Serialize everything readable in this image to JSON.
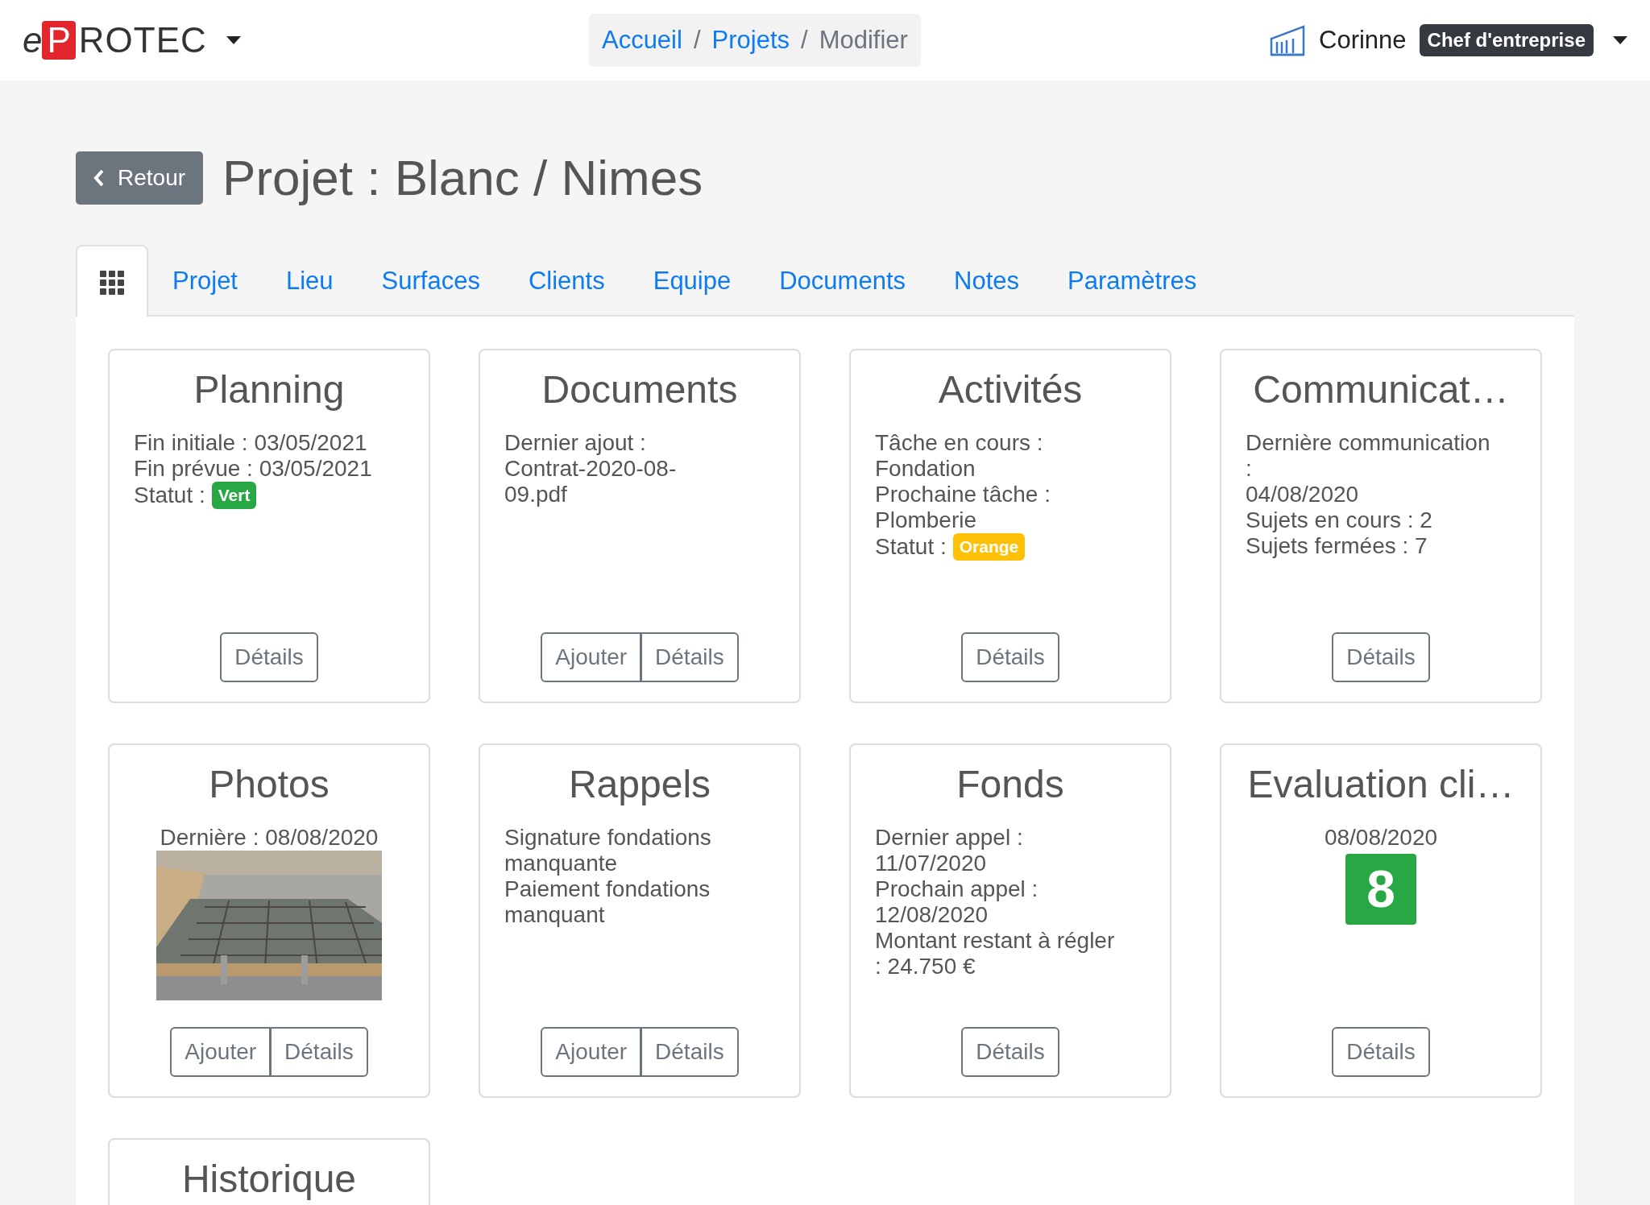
{
  "header": {
    "logo": {
      "prefix": "e",
      "mark": "P",
      "rest": "ROTEC"
    },
    "breadcrumb": [
      {
        "label": "Accueil",
        "link": true
      },
      {
        "label": "Projets",
        "link": true
      },
      {
        "label": "Modifier",
        "link": false
      }
    ],
    "separator": "/",
    "user": {
      "name": "Corinne",
      "role": "Chef d'entreprise"
    }
  },
  "back_button": "Retour",
  "title": "Projet : Blanc / Nimes",
  "tabs": [
    {
      "kind": "icon",
      "selected": true
    },
    {
      "kind": "text",
      "label": "Projet",
      "selected": false
    },
    {
      "kind": "text",
      "label": "Lieu",
      "selected": false
    },
    {
      "kind": "text",
      "label": "Surfaces",
      "selected": false
    },
    {
      "kind": "text",
      "label": "Clients",
      "selected": false
    },
    {
      "kind": "text",
      "label": "Equipe",
      "selected": false
    },
    {
      "kind": "text",
      "label": "Documents",
      "selected": false
    },
    {
      "kind": "text",
      "label": "Notes",
      "selected": false
    },
    {
      "kind": "text",
      "label": "Paramètres",
      "selected": false
    }
  ],
  "cards": [
    {
      "kind": "lines",
      "title": "Planning",
      "lines": [
        {
          "text": "Fin initiale : 03/05/2021"
        },
        {
          "text": "Fin prévue : 03/05/2021"
        },
        {
          "text": "Statut :",
          "badge": {
            "text": "Vert",
            "color": "#28a745"
          }
        }
      ],
      "buttons": [
        "Détails"
      ]
    },
    {
      "kind": "lines",
      "title": "Documents",
      "lines": [
        {
          "text": "Dernier ajout :"
        },
        {
          "text": "Contrat-2020-08-"
        },
        {
          "text": "09.pdf"
        }
      ],
      "buttons": [
        "Ajouter",
        "Détails"
      ]
    },
    {
      "kind": "lines",
      "title": "Activités",
      "lines": [
        {
          "text": "Tâche en cours :"
        },
        {
          "text": "Fondation"
        },
        {
          "text": "Prochaine tâche :"
        },
        {
          "text": "Plomberie"
        },
        {
          "text": "Statut :",
          "badge": {
            "text": "Orange",
            "color": "#ffc107"
          }
        }
      ],
      "buttons": [
        "Détails"
      ]
    },
    {
      "kind": "lines",
      "title": "Communicat…",
      "lines": [
        {
          "text": "Dernière communication"
        },
        {
          "text": ":"
        },
        {
          "text": "04/08/2020"
        },
        {
          "text": "Sujets en cours : 2"
        },
        {
          "text": "Sujets fermées : 7"
        }
      ],
      "buttons": [
        "Détails"
      ]
    },
    {
      "title": "Photos",
      "caption": "Dernière : 08/08/2020",
      "buttons": [
        "Ajouter",
        "Détails"
      ]
    },
    {
      "kind": "lines",
      "title": "Rappels",
      "lines": [
        {
          "text": "Signature fondations"
        },
        {
          "text": "manquante"
        },
        {
          "text": "Paiement fondations"
        },
        {
          "text": "manquant"
        }
      ],
      "buttons": [
        "Ajouter",
        "Détails"
      ]
    },
    {
      "kind": "lines",
      "title": "Fonds",
      "lines": [
        {
          "text": "Dernier appel :"
        },
        {
          "text": "11/07/2020"
        },
        {
          "text": "Prochain appel :"
        },
        {
          "text": "12/08/2020"
        },
        {
          "text": "Montant restant à régler"
        },
        {
          "text": ": 24.750 €"
        }
      ],
      "buttons": [
        "Détails"
      ]
    },
    {
      "kind": "score",
      "title": "Evaluation cli…",
      "caption": "08/08/2020",
      "score": "8",
      "color": "#28a745",
      "buttons": [
        "Détails"
      ]
    },
    {
      "kind": "lines",
      "title": "Historique"
    }
  ]
}
